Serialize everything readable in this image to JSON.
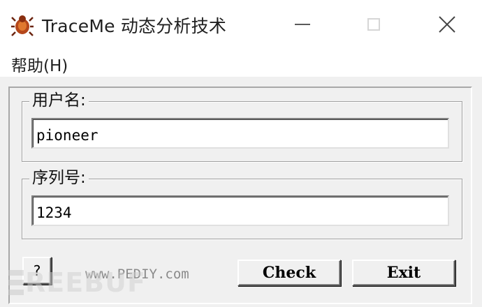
{
  "window": {
    "title": "TraceMe 动态分析技术",
    "controls": {
      "minimize_icon": "minimize-icon",
      "maximize_icon": "maximize-icon",
      "close_icon": "close-icon"
    }
  },
  "menu": {
    "items": [
      {
        "label": "帮助(H)"
      }
    ]
  },
  "form": {
    "username": {
      "label": "用户名:",
      "value": "pioneer"
    },
    "serial": {
      "label": "序列号:",
      "value": "1234"
    }
  },
  "buttons": {
    "help_label": "?",
    "check_label": "Check",
    "exit_label": "Exit"
  },
  "footer": {
    "site_text": "www.PEDIY.com",
    "watermark_text": "REEBUF"
  },
  "colors": {
    "dialog_background": "#f0f0f0",
    "titlebar_background": "#ffffff",
    "text": "#000000"
  }
}
